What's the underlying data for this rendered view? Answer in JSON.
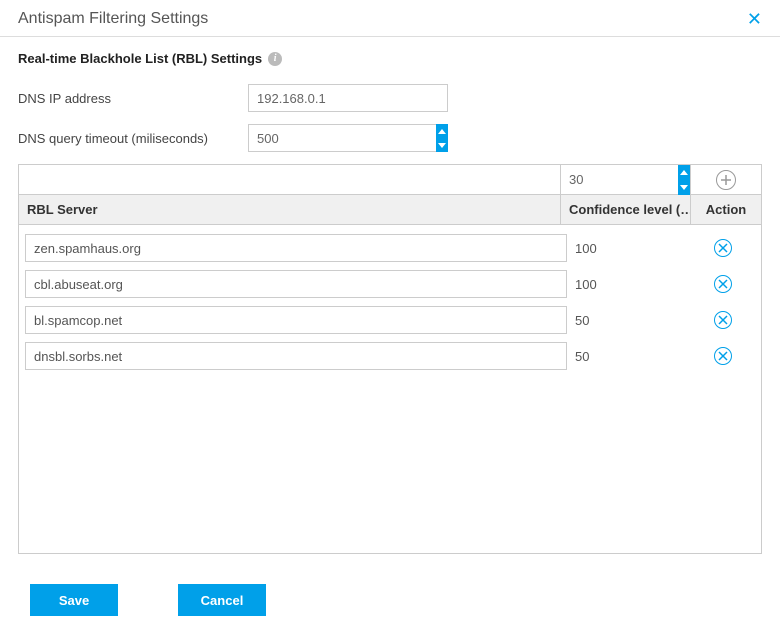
{
  "header": {
    "title": "Antispam Filtering Settings"
  },
  "section": {
    "title": "Real-time Blackhole List (RBL) Settings"
  },
  "form": {
    "dns_ip_label": "DNS IP address",
    "dns_ip_value": "192.168.0.1",
    "dns_timeout_label": "DNS query timeout (miliseconds)",
    "dns_timeout_value": "500"
  },
  "add": {
    "server_value": "",
    "confidence_value": "30"
  },
  "columns": {
    "server": "RBL Server",
    "confidence": "Confidence level (…",
    "action": "Action"
  },
  "rows": [
    {
      "server": "zen.spamhaus.org",
      "confidence": "100"
    },
    {
      "server": "cbl.abuseat.org",
      "confidence": "100"
    },
    {
      "server": "bl.spamcop.net",
      "confidence": "50"
    },
    {
      "server": "dnsbl.sorbs.net",
      "confidence": "50"
    }
  ],
  "buttons": {
    "save": "Save",
    "cancel": "Cancel"
  },
  "colors": {
    "accent": "#00a0e9"
  }
}
